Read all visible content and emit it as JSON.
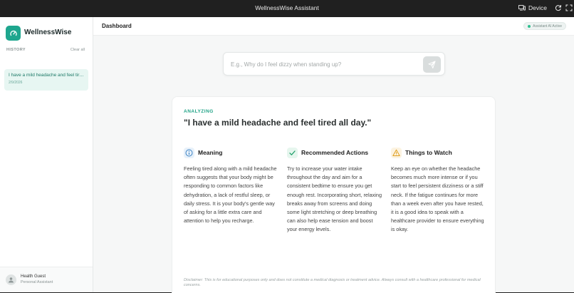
{
  "window": {
    "title": "WellnessWise Assistant",
    "device_label": "Device"
  },
  "sidebar": {
    "brand": "WellnessWise",
    "history_label": "HISTORY",
    "clear_all": "Clear all",
    "history": [
      {
        "text": "I have a mild headache and feel tired all day.",
        "date": "2/9/2026"
      }
    ],
    "user": {
      "name": "Health Guest",
      "role": "Personal Assistant"
    }
  },
  "header": {
    "breadcrumb": "Dashboard",
    "status_badge": "Assistant AI Active"
  },
  "search": {
    "placeholder": "E.g., Why do I feel dizzy when standing up?",
    "value": ""
  },
  "result": {
    "status": "ANALYZING",
    "query": "\"I have a mild headache and feel tired all day.\"",
    "sections": [
      {
        "icon": "info-icon",
        "title": "Meaning",
        "body": "Feeling tired along with a mild headache often suggests that your body might be responding to common factors like dehydration, a lack of restful sleep, or daily stress. It is your body's gentle way of asking for a little extra care and attention to help you recharge."
      },
      {
        "icon": "check-icon",
        "title": "Recommended Actions",
        "body": "Try to increase your water intake throughout the day and aim for a consistent bedtime to ensure you get enough rest. Incorporating short, relaxing breaks away from screens and doing some light stretching or deep breathing can also help ease tension and boost your energy levels."
      },
      {
        "icon": "warning-icon",
        "title": "Things to Watch",
        "body": "Keep an eye on whether the headache becomes much more intense or if you start to feel persistent dizziness or a stiff neck. If the fatigue continues for more than a week even after you have rested, it is a good idea to speak with a healthcare provider to ensure everything is okay."
      }
    ],
    "disclaimer": "Disclaimer: This is for educational purposes only and does not constitute a medical diagnosis or treatment advice. Always consult with a healthcare professional for medical concerns."
  },
  "colors": {
    "accent": "#1ea68e",
    "info": "#3b82c4",
    "success": "#22a06b",
    "warning": "#e0a020"
  }
}
